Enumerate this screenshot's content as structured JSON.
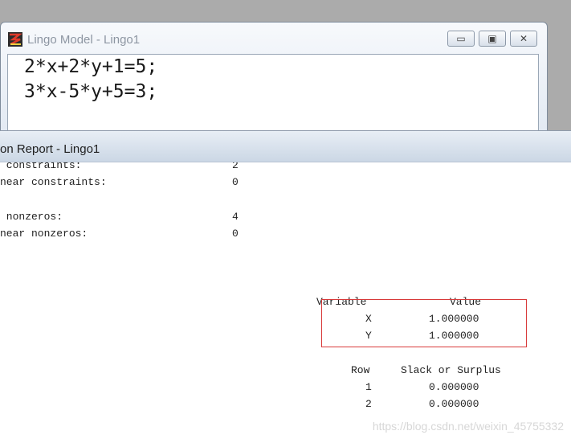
{
  "model_window": {
    "title": "Lingo Model - Lingo1",
    "icon": "lingo-app-icon",
    "buttons": {
      "minimize": "▭",
      "maximize": "▣",
      "close": "✕"
    },
    "code_lines": [
      "2*x+2*y+1=5;",
      "3*x-5*y+5=3;"
    ]
  },
  "report_window": {
    "title": "on Report - Lingo1",
    "stats": [
      {
        "label": " constraints:",
        "value": "2"
      },
      {
        "label": "near constraints:",
        "value": "0"
      },
      {
        "label": " nonzeros:",
        "value": "4"
      },
      {
        "label": "near nonzeros:",
        "value": "0"
      }
    ],
    "variables_table": {
      "headers": [
        "Variable",
        "Value"
      ],
      "rows": [
        {
          "name": "X",
          "value": "1.000000"
        },
        {
          "name": "Y",
          "value": "1.000000"
        }
      ]
    },
    "rows_table": {
      "headers": [
        "Row",
        "Slack or Surplus"
      ],
      "rows": [
        {
          "row": "1",
          "value": "0.000000"
        },
        {
          "row": "2",
          "value": "0.000000"
        }
      ]
    }
  },
  "watermark": "https://blog.csdn.net/weixin_45755332",
  "colors": {
    "highlight": "#d83a3a",
    "desktop": "#ababab"
  }
}
